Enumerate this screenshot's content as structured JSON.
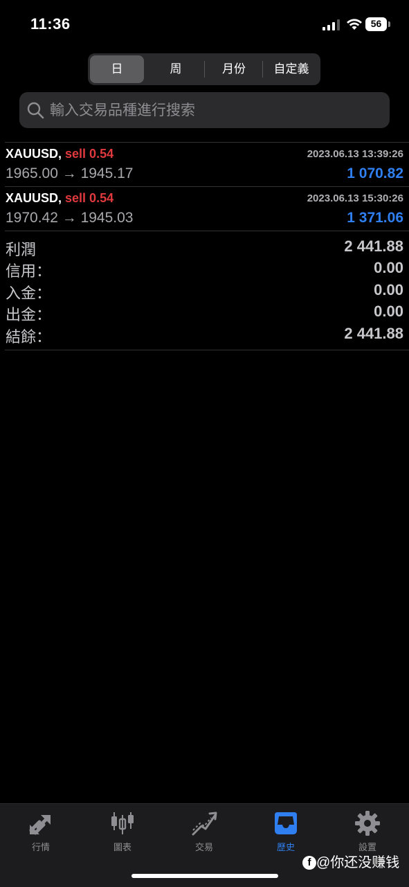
{
  "status_bar": {
    "time": "11:36",
    "battery": "56"
  },
  "period_tabs": [
    "日",
    "周",
    "月份",
    "自定義"
  ],
  "active_period": "日",
  "search": {
    "placeholder": "輸入交易品種進行搜索"
  },
  "deals": [
    {
      "symbol": "XAUUSD,",
      "side": "sell 0.54",
      "datetime": "2023.06.13 13:39:26",
      "prices": "1965.00 → 1945.17",
      "profit": "1 070.82"
    },
    {
      "symbol": "XAUUSD,",
      "side": "sell 0.54",
      "datetime": "2023.06.13 15:30:26",
      "prices": "1970.42 → 1945.03",
      "profit": "1 371.06"
    }
  ],
  "summary": [
    {
      "label": "利潤",
      "value": "2 441.88"
    },
    {
      "label": "信用：",
      "value": "0.00"
    },
    {
      "label": "入金：",
      "value": "0.00"
    },
    {
      "label": "出金：",
      "value": "0.00"
    },
    {
      "label": "結餘：",
      "value": "2 441.88"
    }
  ],
  "tabbar": [
    {
      "label": "行情",
      "icon": "arrows-icon",
      "active": false
    },
    {
      "label": "圖表",
      "icon": "candlestick-icon",
      "active": false
    },
    {
      "label": "交易",
      "icon": "trend-icon",
      "active": false
    },
    {
      "label": "歷史",
      "icon": "inbox-icon",
      "active": true
    },
    {
      "label": "設置",
      "icon": "gear-icon",
      "active": false
    }
  ],
  "watermark": "@你还没赚钱",
  "colors": {
    "accent": "#2f7ff0",
    "sell": "#e0393e",
    "background": "#000000"
  }
}
